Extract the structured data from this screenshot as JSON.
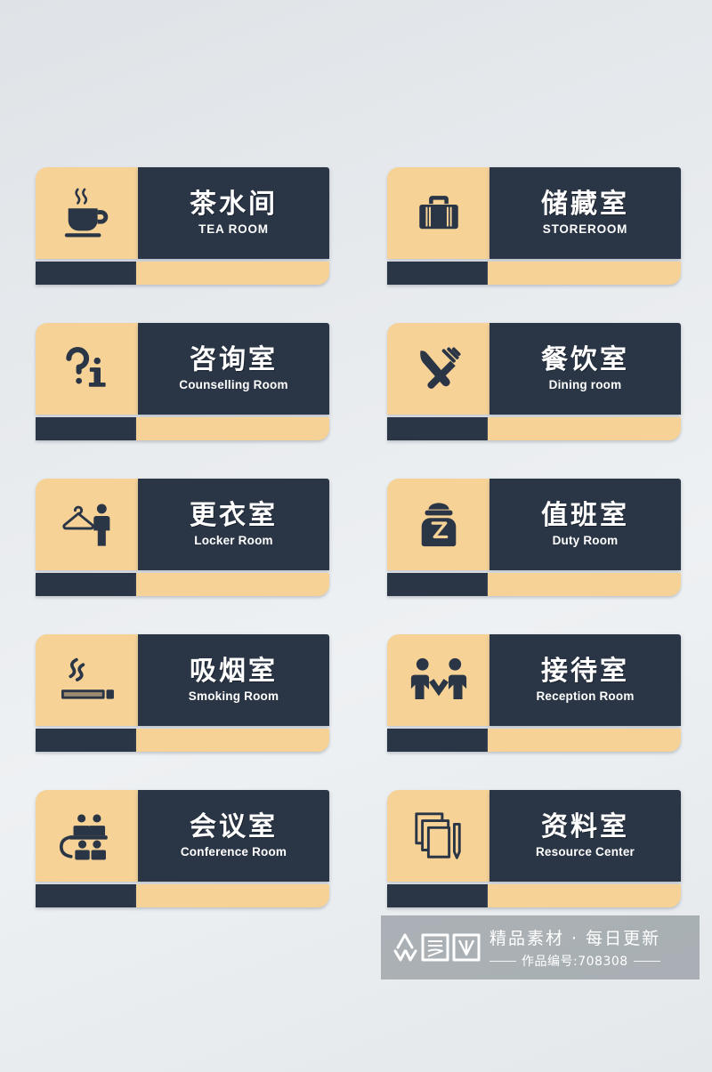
{
  "palette": {
    "tan": "#f7d296",
    "navy": "#2a3546",
    "text_on_navy": "#ffffff",
    "background_top": "#dfe3e7",
    "background_bottom": "#e4e8eb",
    "watermark_bg": "#92989e"
  },
  "signs": [
    {
      "id": "tea-room",
      "icon": "coffee-cup-icon",
      "title_cn": "茶水间",
      "title_en": "TEA ROOM",
      "en_style": "caps",
      "row": 0,
      "col": 0
    },
    {
      "id": "storeroom",
      "icon": "suitcase-icon",
      "title_cn": "储藏室",
      "title_en": "STOREROOM",
      "en_style": "caps",
      "row": 0,
      "col": 1
    },
    {
      "id": "counselling-room",
      "icon": "question-info-icon",
      "title_cn": "咨询室",
      "title_en": "Counselling Room",
      "en_style": "normal",
      "row": 1,
      "col": 0
    },
    {
      "id": "dining-room",
      "icon": "fork-knife-icon",
      "title_cn": "餐饮室",
      "title_en": "Dining room",
      "en_style": "normal",
      "row": 1,
      "col": 1
    },
    {
      "id": "locker-room",
      "icon": "hanger-person-icon",
      "title_cn": "更衣室",
      "title_en": "Locker Room",
      "en_style": "normal",
      "row": 2,
      "col": 0
    },
    {
      "id": "duty-room",
      "icon": "guard-officer-icon",
      "title_cn": "值班室",
      "title_en": "Duty Room",
      "en_style": "normal",
      "row": 2,
      "col": 1
    },
    {
      "id": "smoking-room",
      "icon": "cigarette-icon",
      "title_cn": "吸烟室",
      "title_en": "Smoking Room",
      "en_style": "normal",
      "row": 3,
      "col": 0
    },
    {
      "id": "reception-room",
      "icon": "handshake-people-icon",
      "title_cn": "接待室",
      "title_en": "Reception Room",
      "en_style": "normal",
      "row": 3,
      "col": 1
    },
    {
      "id": "conference-room",
      "icon": "meeting-table-icon",
      "title_cn": "会议室",
      "title_en": "Conference Room",
      "en_style": "normal",
      "row": 4,
      "col": 0
    },
    {
      "id": "resource-center",
      "icon": "documents-stack-icon",
      "title_cn": "资料室",
      "title_en": "Resource Center",
      "en_style": "normal",
      "row": 4,
      "col": 1
    }
  ],
  "watermark": {
    "logo_text": "众图网",
    "tagline": "精品素材 · 每日更新",
    "work_number": "作品编号:708308"
  }
}
